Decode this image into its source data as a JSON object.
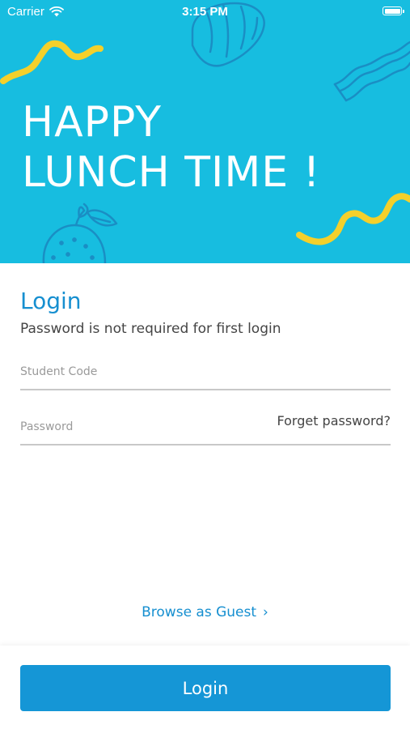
{
  "colors": {
    "hero_background": "#17bde0",
    "accent": "#168fd0",
    "doodle_yellow": "#f4d02b",
    "doodle_blue": "#1a8ec4"
  },
  "status_bar": {
    "carrier": "Carrier",
    "time": "3:15 PM",
    "icons": [
      "wifi-icon",
      "battery-icon"
    ]
  },
  "hero": {
    "title_line1": "HAPPY",
    "title_line2": "LUNCH TIME !",
    "doodles": [
      "croissant-icon",
      "bacon-icon",
      "orange-icon",
      "squiggle"
    ]
  },
  "login": {
    "heading": "Login",
    "note": "Password is not required for first login",
    "student_code_placeholder": "Student Code",
    "password_placeholder": "Password",
    "forget_password": "Forget password?",
    "browse_guest": "Browse as Guest",
    "browse_guest_icon": "chevron-right-icon",
    "submit_label": "Login"
  }
}
